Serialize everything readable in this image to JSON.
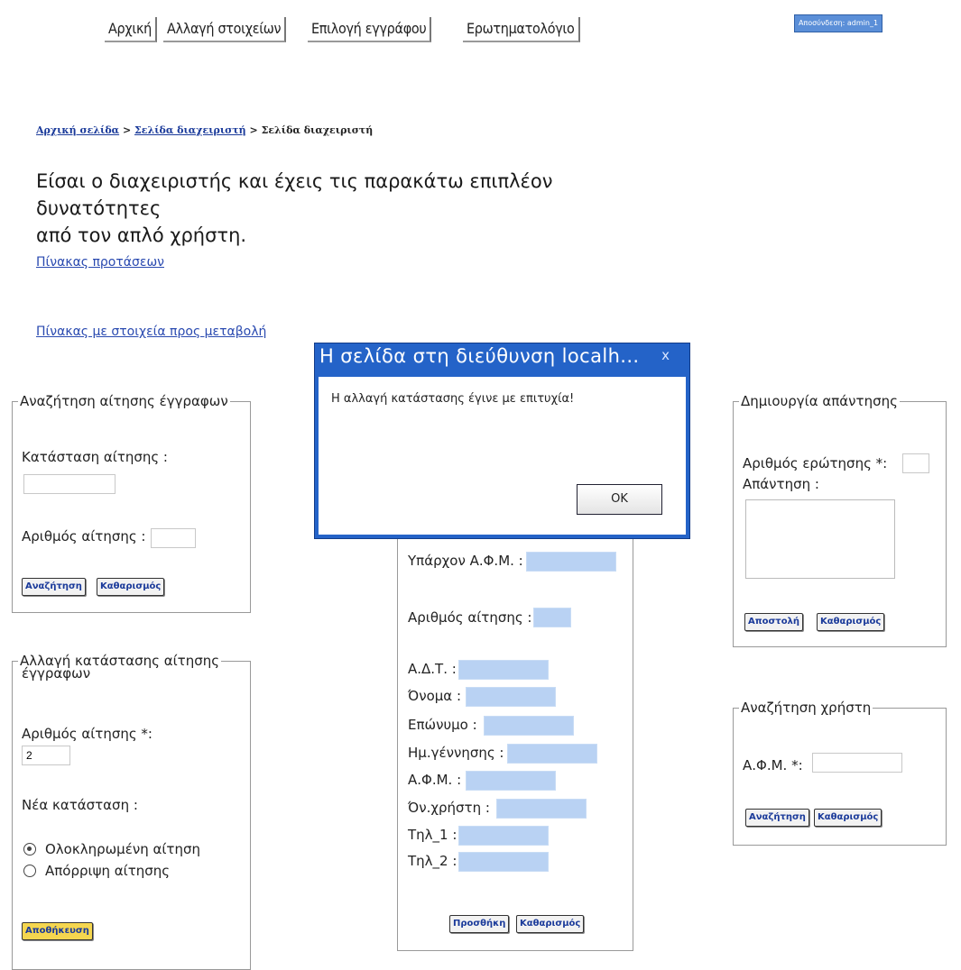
{
  "nav": {
    "home": "Αρχική",
    "change_details": "Αλλαγή στοιχείων",
    "choose_document": "Επιλογή εγγράφου",
    "questionnaire": "Ερωτηματολόγιο",
    "logout_badge": "Αποσύνδεση: admin_1"
  },
  "breadcrumb": {
    "home": "Αρχική σελίδα",
    "sep": " > ",
    "admin1": "Σελίδα διαχειριστή",
    "admin2": "Σελίδα διαχειριστή"
  },
  "intro": {
    "line1": "Είσαι ο διαχειριστής και έχεις τις παρακάτω επιπλέον δυνατότητες",
    "line2": "από τον απλό χρήστη."
  },
  "links": {
    "proposals": "Πίνακας προτάσεων",
    "changes": "Πίνακας με στοιχεία προς μεταβολή"
  },
  "search_request": {
    "legend": "Αναζήτηση αίτησης έγγραφων",
    "status_label": "Κατάσταση αίτησης :",
    "number_label": "Αριθμός αίτησης :",
    "search_btn": "Αναζήτηση",
    "clear_btn": "Καθαρισμός"
  },
  "change_status": {
    "legend_line1": "Αλλαγή κατάστασης αίτησης",
    "legend_line2": "έγγραφων",
    "number_label": "Αριθμός αίτησης *:",
    "number_value": "2",
    "new_status_label": "Νέα κατάσταση :",
    "option_completed": "Ολοκληρωμένη αίτηση",
    "option_rejected": "Απόρριψη αίτησης",
    "save_btn": "Αποθήκευση"
  },
  "add_user": {
    "existing_afm": "Υπάρχον Α.Φ.Μ. :",
    "request_number": "Αριθμός αίτησης :",
    "adt": "Α.Δ.Τ. :",
    "first_name": "Όνομα :",
    "last_name": "Επώνυμο :",
    "birth_date": "Ημ.γέννησης :",
    "afm": "Α.Φ.Μ. :",
    "username": "Όν.χρήστη :",
    "phone1": "Τηλ_1 :",
    "phone2": "Τηλ_2 :",
    "add_btn": "Προσθήκη",
    "clear_btn": "Καθαρισμός"
  },
  "create_answer": {
    "legend": "Δημιουργία απάντησης",
    "question_number": "Αριθμός ερώτησης *:",
    "answer": "Απάντηση :",
    "send_btn": "Αποστολή",
    "clear_btn": "Καθαρισμός"
  },
  "search_user": {
    "legend": "Αναζήτηση χρήστη",
    "afm": "Α.Φ.Μ. *:",
    "search_btn": "Αναζήτηση",
    "clear_btn": "Καθαρισμός"
  },
  "dialog": {
    "title": "Η σελίδα στη διεύθυνση localh...",
    "close": "x",
    "message": "Η αλλαγή κατάστασης έγινε με επιτυχία!",
    "ok": "OK"
  },
  "colors": {
    "dialog_blue": "#2463c8",
    "field_blue": "#b9d2f3",
    "save_yellow": "#f5d64f"
  }
}
